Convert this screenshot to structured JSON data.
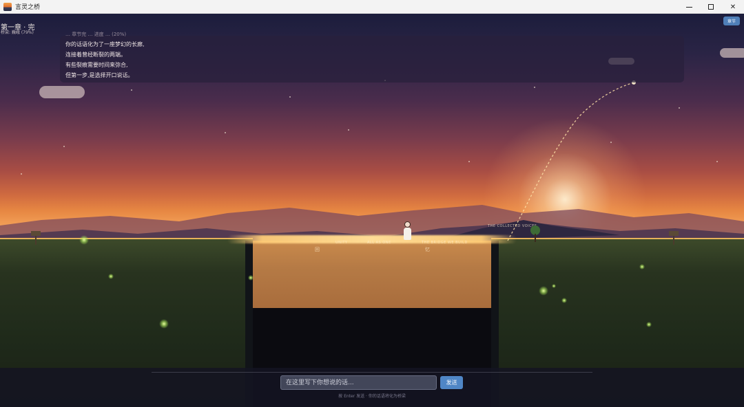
{
  "window": {
    "title": "言灵之桥",
    "controls": {
      "minimize": "minimize-icon",
      "maximize": "maximize-icon",
      "close": "close-icon"
    }
  },
  "hud": {
    "chapter_title": "第一章 · 完",
    "chapter_progress": "桥梁: 巍峨 (79%)",
    "bridge_progress_percent": 79,
    "chapter_button_label": "章节"
  },
  "story": {
    "cut_line": "… 章节完 … 进度 … (20%)",
    "lines": [
      "你的话语化为了一座梦幻的长廊,",
      "连接着曾经断裂的两端。",
      "有些裂痕需要时间来弥合,",
      "但第一步,是选择开口说话。"
    ]
  },
  "scene": {
    "bridge_words": [
      "UNITY",
      "ALL AS ONE",
      "THE BRIDGE WE BUILD",
      "THE COLLECTED VOICES"
    ],
    "bridge_glyphs": [
      "回",
      "忆"
    ]
  },
  "input": {
    "placeholder": "在这里写下你想说的话...",
    "value": "",
    "send_label": "发送",
    "hint": "按 Enter 发送 · 你的话语将化为桥梁"
  },
  "colors": {
    "accent": "#4f86c6",
    "bridge_glow": "#ffd48a"
  }
}
